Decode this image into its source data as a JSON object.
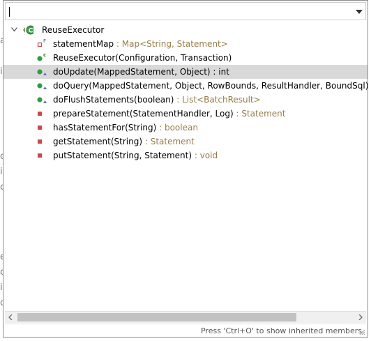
{
  "filter": {
    "value": "",
    "placeholder": ""
  },
  "tree": {
    "root": {
      "label": "ReuseExecutor",
      "icon": "class-icon"
    },
    "members": [
      {
        "name": "statementMap",
        "sep": " : ",
        "type": "Map<String, Statement>",
        "icon": "private-field-final-icon",
        "visibility": "private",
        "kind": "field"
      },
      {
        "name": "ReuseExecutor(Configuration, Transaction)",
        "sep": "",
        "type": "",
        "icon": "public-constructor-icon",
        "visibility": "public",
        "kind": "constructor"
      },
      {
        "name": "doUpdate(MappedStatement, Object)",
        "sep": " : ",
        "type": "int",
        "icon": "public-override-method-icon",
        "visibility": "public",
        "kind": "override",
        "selected": true
      },
      {
        "name": "doQuery(MappedStatement, Object, RowBounds, ResultHandler, BoundSql)",
        "sep": " <",
        "type": "",
        "icon": "public-override-method-icon",
        "visibility": "public",
        "kind": "override"
      },
      {
        "name": "doFlushStatements(boolean)",
        "sep": " : ",
        "type": "List<BatchResult>",
        "icon": "public-override-method-icon",
        "visibility": "public",
        "kind": "override"
      },
      {
        "name": "prepareStatement(StatementHandler, Log)",
        "sep": " : ",
        "type": "Statement",
        "icon": "private-method-icon",
        "visibility": "private",
        "kind": "method"
      },
      {
        "name": "hasStatementFor(String)",
        "sep": " : ",
        "type": "boolean",
        "icon": "private-method-icon",
        "visibility": "private",
        "kind": "method"
      },
      {
        "name": "getStatement(String)",
        "sep": " : ",
        "type": "Statement",
        "icon": "private-method-icon",
        "visibility": "private",
        "kind": "method"
      },
      {
        "name": "putStatement(String, Statement)",
        "sep": " : ",
        "type": "void",
        "icon": "private-method-icon",
        "visibility": "private",
        "kind": "method"
      }
    ]
  },
  "status": {
    "hint": "Press 'Ctrl+O' to show inherited members"
  },
  "colors": {
    "public": "#2e9e3e",
    "private": "#d0454b",
    "type": "#957d47",
    "selection": "#d9d9d9"
  }
}
